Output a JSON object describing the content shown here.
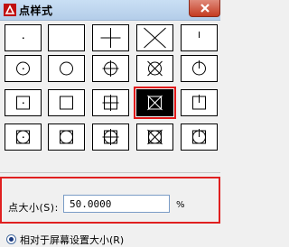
{
  "window": {
    "title": "点样式"
  },
  "point_styles": {
    "selected_index": 13,
    "styles": [
      "dot",
      "none",
      "plus",
      "x",
      "tick",
      "circle-dot",
      "circle",
      "circle-plus",
      "circle-x",
      "circle-tick",
      "square-dot",
      "square",
      "square-plus",
      "square-x",
      "square-tick",
      "square-circle-dot",
      "square-circle",
      "square-circle-plus",
      "square-circle-x",
      "square-circle-tick"
    ]
  },
  "point_size": {
    "label": "点大小(S):",
    "value": "50.0000",
    "unit": "%"
  },
  "size_mode": {
    "option_label": "相对于屏幕设置大小(R)",
    "selected": true
  }
}
